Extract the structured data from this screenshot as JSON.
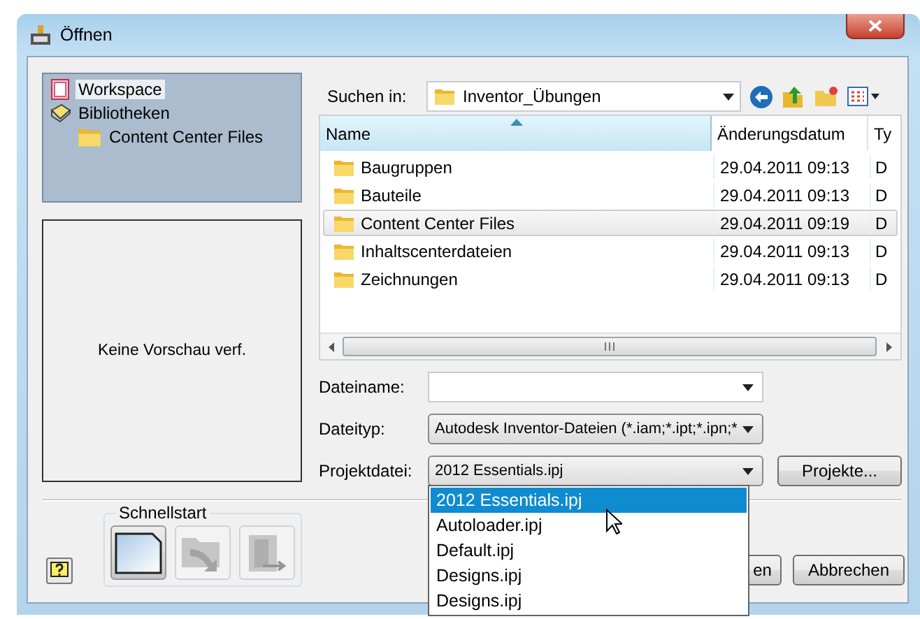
{
  "window": {
    "title": "Öffnen"
  },
  "sidebar": {
    "items": [
      {
        "label": "Workspace",
        "kind": "workspace",
        "selected": true
      },
      {
        "label": "Bibliotheken",
        "kind": "library",
        "selected": false,
        "children": [
          {
            "label": "Content Center Files",
            "kind": "folder",
            "selected": false
          }
        ]
      }
    ]
  },
  "preview": {
    "text": "Keine Vorschau verf."
  },
  "look_in": {
    "label": "Suchen in:",
    "value": "Inventor_Übungen"
  },
  "file_list": {
    "columns": [
      {
        "label": "Name",
        "sorted": true
      },
      {
        "label": "Änderungsdatum",
        "sorted": false
      },
      {
        "label": "Ty",
        "sorted": false
      }
    ],
    "rows": [
      {
        "name": "Baugruppen",
        "date": "29.04.2011 09:13",
        "type": "D",
        "selected": false
      },
      {
        "name": "Bauteile",
        "date": "29.04.2011 09:13",
        "type": "D",
        "selected": false
      },
      {
        "name": "Content Center Files",
        "date": "29.04.2011 09:19",
        "type": "D",
        "selected": true
      },
      {
        "name": "Inhaltscenterdateien",
        "date": "29.04.2011 09:13",
        "type": "D",
        "selected": false
      },
      {
        "name": "Zeichnungen",
        "date": "29.04.2011 09:13",
        "type": "D",
        "selected": false
      }
    ]
  },
  "fields": [
    {
      "label": "Dateiname:",
      "kind": "combo"
    },
    {
      "label": "Dateityp:",
      "kind": "dropdown",
      "value": "Autodesk Inventor-Dateien (*.iam;*.ipt;*.ipn;*"
    },
    {
      "label": "Projektdatei:",
      "kind": "dropdown",
      "value": "2012 Essentials.ipj"
    }
  ],
  "projects_button": "Projekte...",
  "project_options": [
    {
      "label": "2012 Essentials.ipj",
      "selected": true
    },
    {
      "label": "Autoloader.ipj",
      "selected": false
    },
    {
      "label": "Default.ipj",
      "selected": false
    },
    {
      "label": "Designs.ipj",
      "selected": false
    },
    {
      "label": "Designs.ipj",
      "selected": false
    }
  ],
  "quickstart": {
    "label": "Schnellstart",
    "buttons": [
      {
        "kind": "new",
        "disabled": false
      },
      {
        "kind": "open",
        "disabled": true
      },
      {
        "kind": "exit",
        "disabled": true
      }
    ]
  },
  "buttons": [
    "en",
    "Abbrechen"
  ]
}
